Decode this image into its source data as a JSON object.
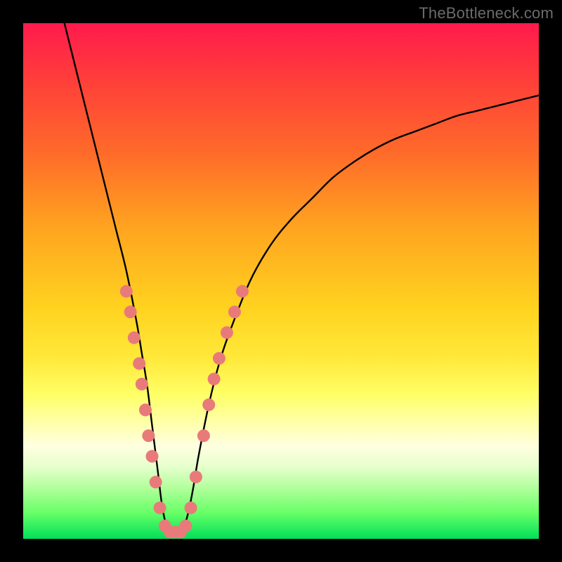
{
  "watermark": "TheBottleneck.com",
  "chart_data": {
    "type": "line",
    "title": "",
    "xlabel": "",
    "ylabel": "",
    "xlim": [
      0,
      100
    ],
    "ylim": [
      0,
      100
    ],
    "grid": false,
    "series": [
      {
        "name": "bottleneck-curve",
        "x": [
          8,
          10,
          12,
          14,
          16,
          18,
          20,
          22,
          23,
          24,
          25,
          26,
          27,
          28,
          29,
          30,
          31,
          32,
          33,
          34,
          36,
          38,
          40,
          44,
          48,
          52,
          56,
          60,
          64,
          68,
          72,
          76,
          80,
          84,
          88,
          92,
          96,
          100
        ],
        "values": [
          100,
          92,
          84,
          76,
          68,
          60,
          52,
          42,
          36,
          30,
          22,
          14,
          6,
          2,
          1,
          1,
          2,
          5,
          10,
          16,
          26,
          34,
          40,
          50,
          57,
          62,
          66,
          70,
          73,
          75.5,
          77.5,
          79,
          80.5,
          82,
          83,
          84,
          85,
          86
        ]
      }
    ],
    "markers": [
      {
        "x": 20.0,
        "y": 48
      },
      {
        "x": 20.8,
        "y": 44
      },
      {
        "x": 21.5,
        "y": 39
      },
      {
        "x": 22.5,
        "y": 34
      },
      {
        "x": 23.0,
        "y": 30
      },
      {
        "x": 23.7,
        "y": 25
      },
      {
        "x": 24.3,
        "y": 20
      },
      {
        "x": 25.0,
        "y": 16
      },
      {
        "x": 25.7,
        "y": 11
      },
      {
        "x": 26.5,
        "y": 6
      },
      {
        "x": 27.5,
        "y": 2.5
      },
      {
        "x": 28.5,
        "y": 1.3
      },
      {
        "x": 29.5,
        "y": 1.3
      },
      {
        "x": 30.5,
        "y": 1.3
      },
      {
        "x": 31.5,
        "y": 2.5
      },
      {
        "x": 32.5,
        "y": 6
      },
      {
        "x": 33.5,
        "y": 12
      },
      {
        "x": 35.0,
        "y": 20
      },
      {
        "x": 36.0,
        "y": 26
      },
      {
        "x": 37.0,
        "y": 31
      },
      {
        "x": 38.0,
        "y": 35
      },
      {
        "x": 39.5,
        "y": 40
      },
      {
        "x": 41.0,
        "y": 44
      },
      {
        "x": 42.5,
        "y": 48
      }
    ],
    "marker_style": {
      "color": "#e97a7a",
      "radius_px": 9
    }
  }
}
